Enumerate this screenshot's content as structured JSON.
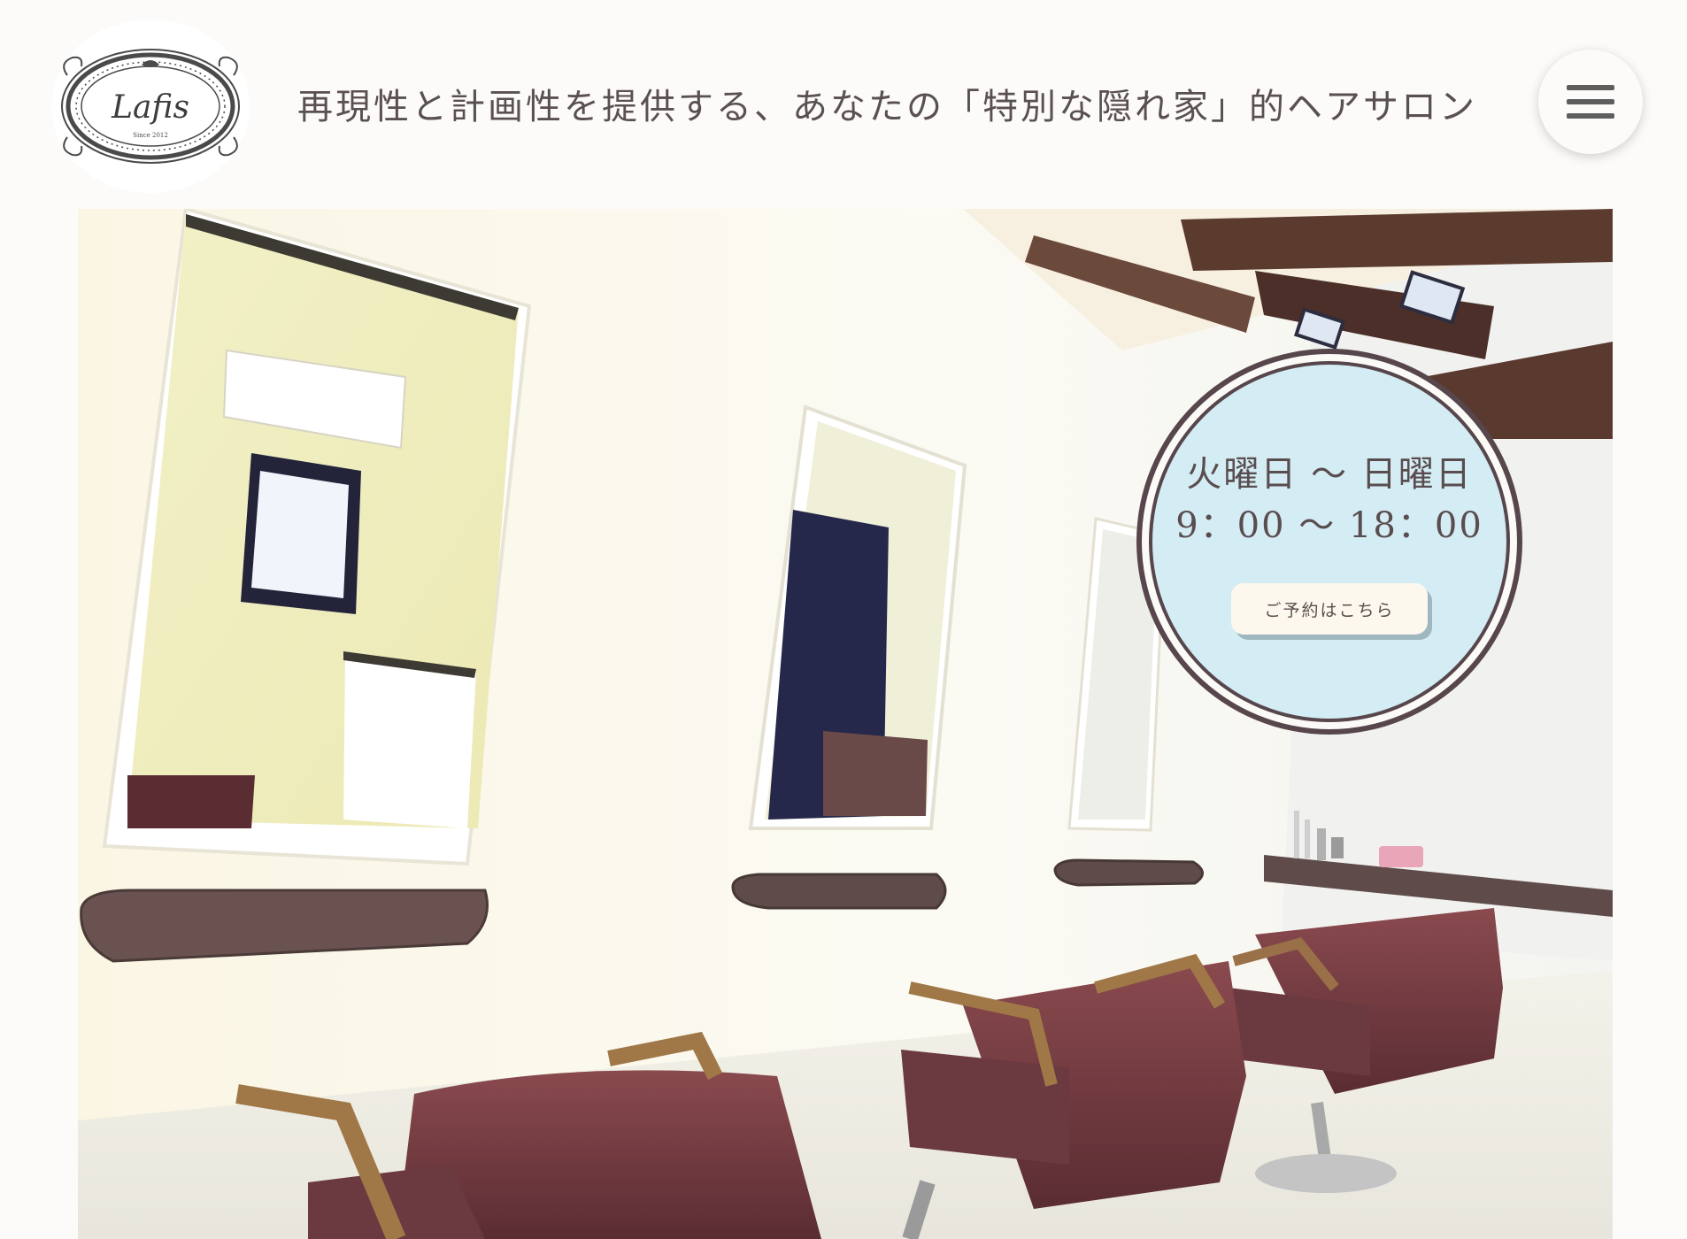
{
  "header": {
    "logo_text": "Lafis",
    "logo_since": "Since 2012",
    "tagline": "再現性と計画性を提供する、あなたの「特別な隠れ家」的ヘアサロン"
  },
  "hours": {
    "days": "火曜日 〜 日曜日",
    "time": "9：00 〜 18：00",
    "reserve_label": "ご予約はこちら"
  },
  "colors": {
    "page_bg": "#fcfbf9",
    "badge_face": "#d4ecf3",
    "badge_border": "#57464c",
    "text": "#5a4d4f"
  },
  "icons": {
    "menu": "hamburger-menu-icon"
  }
}
